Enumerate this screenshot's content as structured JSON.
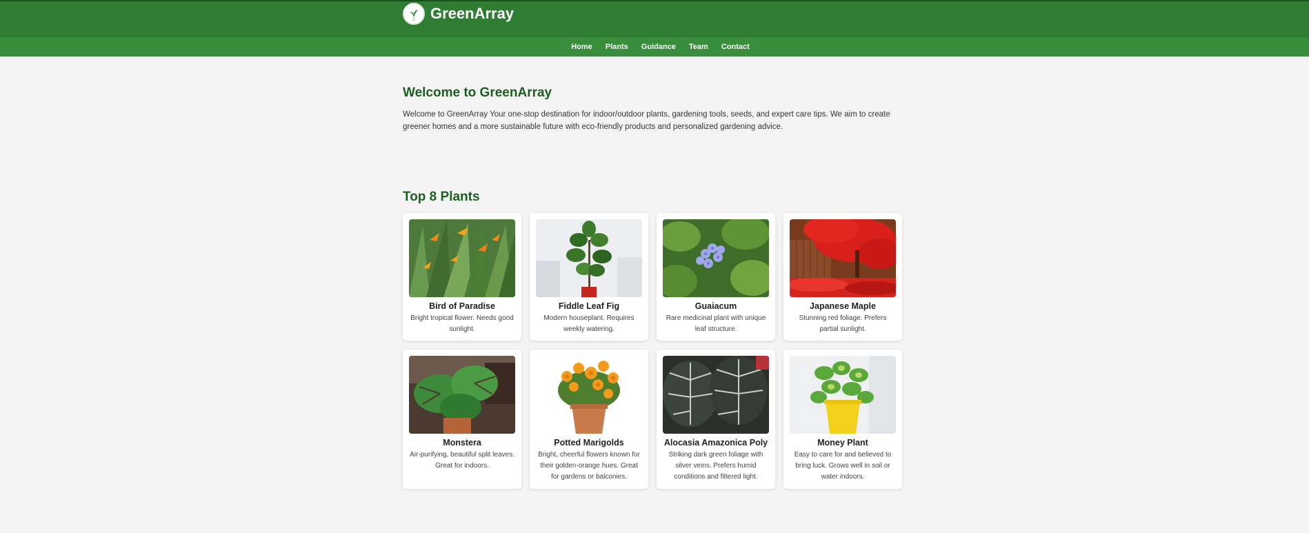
{
  "header": {
    "brand": "GreenArray",
    "logo_icon": "plant-logo-icon",
    "brand_color": "#2e7d32",
    "nav_color": "#388e3c"
  },
  "nav": {
    "items": [
      {
        "label": "Home"
      },
      {
        "label": "Plants"
      },
      {
        "label": "Guidance"
      },
      {
        "label": "Team"
      },
      {
        "label": "Contact"
      }
    ]
  },
  "welcome": {
    "title": "Welcome to GreenArray",
    "text": "Welcome to GreenArray Your one-stop destination for indoor/outdoor plants, gardening tools, seeds, and expert care tips. We aim to create greener homes and a more sustainable future with eco-friendly products and personalized gardening advice."
  },
  "plants": {
    "title": "Top 8 Plants",
    "items": [
      {
        "name": "Bird of Paradise",
        "desc": "Bright tropical flower. Needs good sunlight.",
        "image": "bird-of-paradise-photo"
      },
      {
        "name": "Fiddle Leaf Fig",
        "desc": "Modern houseplant. Requires weekly watering.",
        "image": "fiddle-leaf-fig-photo"
      },
      {
        "name": "Guaiacum",
        "desc": "Rare medicinal plant with unique leaf structure.",
        "image": "guaiacum-photo"
      },
      {
        "name": "Japanese Maple",
        "desc": "Stunning red foliage. Prefers partial sunlight.",
        "image": "japanese-maple-photo"
      },
      {
        "name": "Monstera",
        "desc": "Air-purifying, beautiful split leaves. Great for indoors.",
        "image": "monstera-photo"
      },
      {
        "name": "Potted Marigolds",
        "desc": "Bright, cheerful flowers known for their golden-orange hues. Great for gardens or balconies.",
        "image": "potted-marigolds-photo"
      },
      {
        "name": "Alocasia Amazonica Poly",
        "desc": "Striking dark green foliage with silver veins. Prefers humid conditions and filtered light.",
        "image": "alocasia-photo"
      },
      {
        "name": "Money Plant",
        "desc": "Easy to care for and believed to bring luck. Grows well in soil or water indoors.",
        "image": "money-plant-photo"
      }
    ]
  }
}
